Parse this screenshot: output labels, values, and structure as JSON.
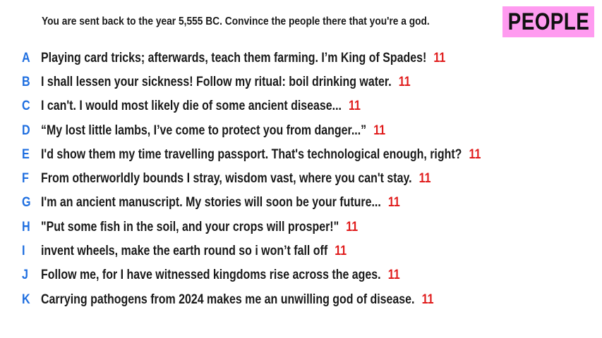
{
  "prompt": "You are sent back to the year 5,555 BC. Convince the people there that you're a god.",
  "category": "PEOPLE",
  "colors": {
    "letter": "#1f6fe0",
    "score": "#e01b1b",
    "category_bg": "#ff9bf0"
  },
  "answers": [
    {
      "letter": "A",
      "text": "Playing card tricks; afterwards, teach them farming. I’m King of Spades!",
      "score": "11"
    },
    {
      "letter": "B",
      "text": "I shall lessen your sickness! Follow my ritual: boil drinking water.",
      "score": "11"
    },
    {
      "letter": "C",
      "text": "I can't. I would most likely die of some ancient disease...",
      "score": "11"
    },
    {
      "letter": "D",
      "text": "“My lost little lambs, I’ve come to protect you from danger...”",
      "score": "11"
    },
    {
      "letter": "E",
      "text": "I'd show them my time travelling passport. That's technological enough, right?",
      "score": "11"
    },
    {
      "letter": "F",
      "text": "From otherworldly bounds I stray, wisdom vast, where you can't stay.",
      "score": "11"
    },
    {
      "letter": "G",
      "text": "I'm an ancient manuscript. My stories will soon be your future...",
      "score": "11"
    },
    {
      "letter": "H",
      "text": "\"Put some fish in the soil, and your crops will prosper!\"",
      "score": "11"
    },
    {
      "letter": "I",
      "text": "invent wheels, make the earth round so i won’t fall off",
      "score": "11"
    },
    {
      "letter": "J",
      "text": "Follow me, for I have witnessed kingdoms rise across the ages.",
      "score": "11"
    },
    {
      "letter": "K",
      "text": "Carrying pathogens from 2024 makes me an unwilling god of disease.",
      "score": "11"
    }
  ]
}
